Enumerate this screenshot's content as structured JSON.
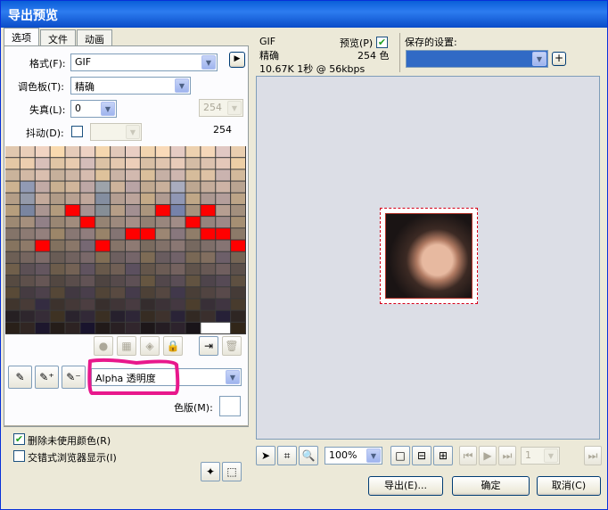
{
  "window": {
    "title": "导出预览"
  },
  "tabs": [
    "选项",
    "文件",
    "动画"
  ],
  "options": {
    "format_label": "格式(F):",
    "format_value": "GIF",
    "palette_label": "调色板(T):",
    "palette_value": "精确",
    "loss_label": "失真(L):",
    "loss_value": "0",
    "dither_label": "抖动(D):",
    "colors_value": "254",
    "colors_count": "254"
  },
  "transparency": {
    "value": "Alpha 透明度"
  },
  "matte": {
    "label": "色版(M):"
  },
  "checkboxes": {
    "remove_unused": "删除未使用颜色(R)",
    "interlaced": "交错式浏览器显示(I)"
  },
  "info": {
    "format": "GIF",
    "palette": "精确",
    "size": "10.67K  1秒 @ 56kbps",
    "preview_label": "预览(P)",
    "colors": "254 色"
  },
  "saved": {
    "label": "保存的设置:"
  },
  "zoom": {
    "value": "100%"
  },
  "frame": {
    "value": "1"
  },
  "buttons": {
    "export": "导出(E)...",
    "ok": "确定",
    "cancel": "取消(C)"
  },
  "colors": {
    "title_bar": "#0a5fd8",
    "highlight_marker": "#e8188c",
    "palette_red": "#ff0000"
  }
}
